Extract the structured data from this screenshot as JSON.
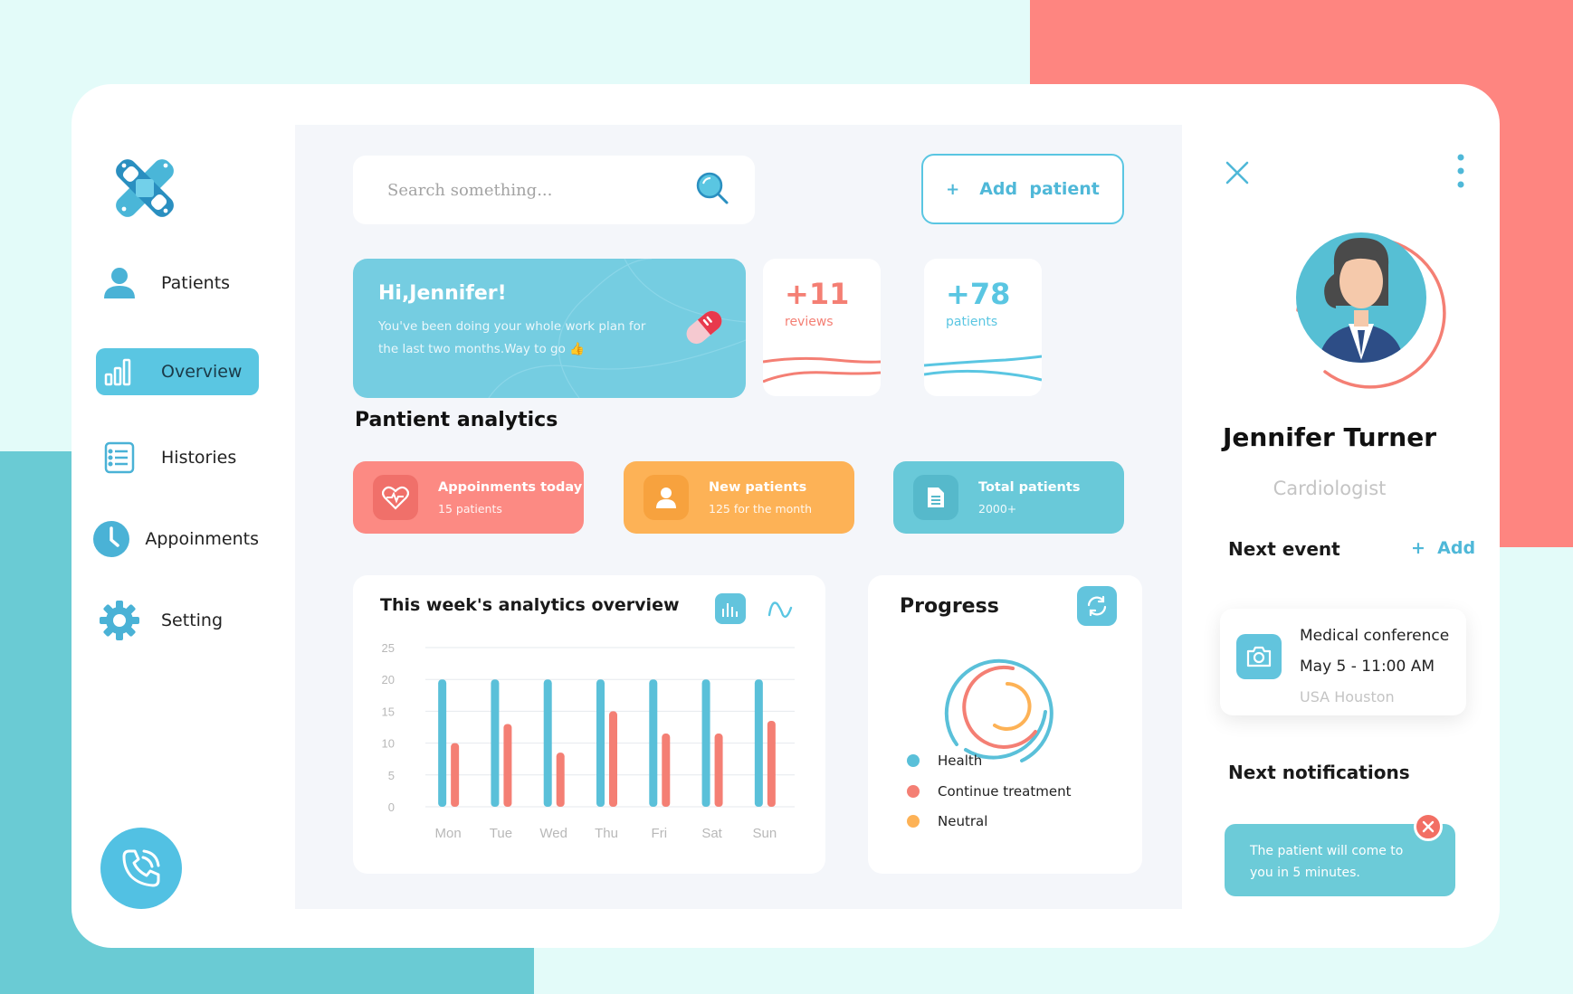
{
  "sidebar": {
    "items": [
      {
        "label": "Patients",
        "icon": "user-icon"
      },
      {
        "label": "Overview",
        "icon": "bar-chart-icon",
        "active": true
      },
      {
        "label": "Histories",
        "icon": "list-icon"
      },
      {
        "label": "Appoinments",
        "icon": "clock-icon"
      },
      {
        "label": "Setting",
        "icon": "gear-icon"
      }
    ]
  },
  "search": {
    "placeholder": "Search something..."
  },
  "header": {
    "add_patient_label": "Add  patient",
    "add_plus": "+"
  },
  "welcome": {
    "title": "Hi,Jennifer!",
    "message": "You've been doing your whole work plan for the last two months.Way to go 👍"
  },
  "stats": [
    {
      "value": "+11",
      "label": "reviews",
      "color": "#f47f74"
    },
    {
      "value": "+78",
      "label": "patients",
      "color": "#5ac6e2"
    }
  ],
  "analytics": {
    "title": "Pantient analytics",
    "cards": [
      {
        "title": "Appoinments today",
        "subtitle": "15 patients",
        "color": "#fc8a83",
        "icon": "heart-pulse-icon"
      },
      {
        "title": "New patients",
        "subtitle": "125 for the month",
        "color": "#fdb256",
        "icon": "user-icon"
      },
      {
        "title": "Total patients",
        "subtitle": "2000+",
        "color": "#69c9d9",
        "icon": "document-icon"
      }
    ]
  },
  "weekly_chart": {
    "title": "This week's analytics overview",
    "y_ticks": [
      "25",
      "20",
      "15",
      "10",
      "5",
      "0"
    ]
  },
  "chart_data": {
    "type": "bar",
    "title": "This week's analytics overview",
    "categories": [
      "Mon",
      "Tue",
      "Wed",
      "Thu",
      "Fri",
      "Sat",
      "Sun"
    ],
    "series": [
      {
        "color": "#5ac0d9",
        "values": [
          20,
          20,
          20,
          20,
          20,
          20,
          20
        ]
      },
      {
        "color": "#f47f74",
        "values": [
          10,
          13,
          8.5,
          15,
          11.5,
          11.5,
          13.5
        ]
      }
    ],
    "ylim": [
      0,
      25
    ],
    "yticks": [
      0,
      5,
      10,
      15,
      20,
      25
    ],
    "grid": true
  },
  "progress": {
    "title": "Progress",
    "legend": [
      {
        "label": "Health",
        "color": "#5ac0d9"
      },
      {
        "label": "Continue treatment",
        "color": "#f47f74"
      },
      {
        "label": "Neutral",
        "color": "#fdb256"
      }
    ]
  },
  "profile": {
    "name": "Jennifer Turner",
    "role": "Cardiologist"
  },
  "next_event": {
    "heading": "Next event",
    "add_label": "+  Add",
    "title": "Medical conference",
    "time": "May 5 - 11:00 AM",
    "location": "USA Houston"
  },
  "notifications": {
    "heading": "Next notifications",
    "message": "The patient will come to you in 5 minutes."
  },
  "colors": {
    "accent": "#5ac6e2",
    "coral": "#fe8580",
    "orange": "#fdb256",
    "teal": "#69c9d9"
  }
}
